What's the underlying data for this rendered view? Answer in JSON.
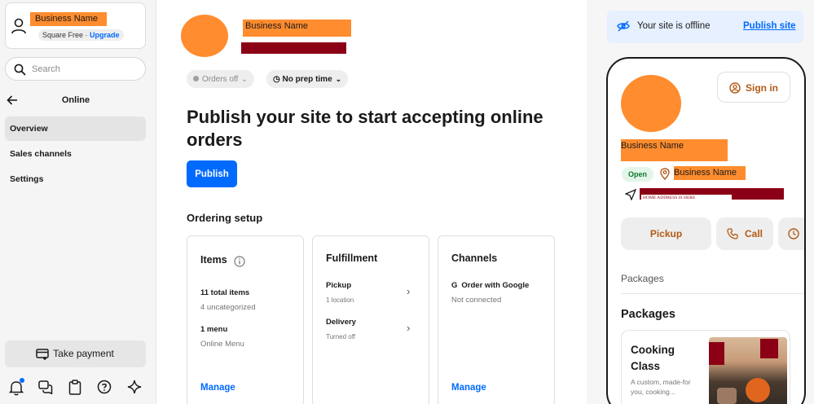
{
  "sidebar": {
    "account": {
      "business_name": "Business Name",
      "plan": "Square Free",
      "upgrade": "Upgrade"
    },
    "search": {
      "placeholder": "Search"
    },
    "section_title": "Online",
    "nav": [
      {
        "label": "Overview",
        "active": true
      },
      {
        "label": "Sales channels",
        "active": false
      },
      {
        "label": "Settings",
        "active": false
      }
    ],
    "take_payment": "Take payment",
    "bottom_icons": [
      "bell-icon",
      "chat-icon",
      "clipboard-icon",
      "help-icon",
      "sparkle-icon"
    ]
  },
  "main": {
    "business_name": "Business Name",
    "pills": {
      "orders": "Orders off",
      "prep": "No prep time"
    },
    "headline": "Publish your site to start accepting online orders",
    "publish_label": "Publish",
    "setup_title": "Ordering setup",
    "cards": {
      "items": {
        "title": "Items",
        "total": "11 total items",
        "uncategorized": "4 uncategorized",
        "menu": "1 menu",
        "menu_name": "Online Menu",
        "manage": "Manage"
      },
      "fulfillment": {
        "title": "Fulfillment",
        "pickup": "Pickup",
        "pickup_sub": "1 location",
        "delivery": "Delivery",
        "delivery_sub": "Turned off"
      },
      "channels": {
        "title": "Channels",
        "google": "Order with Google",
        "google_status": "Not connected",
        "manage": "Manage"
      }
    }
  },
  "right": {
    "banner": {
      "text": "Your site is offline",
      "link": "Publish site"
    },
    "preview": {
      "sign_in": "Sign in",
      "business_name": "Business Name",
      "status": "Open",
      "location_name": "Business Name",
      "address": "HOME ADDRESS IS HERE",
      "buttons": {
        "pickup": "Pickup",
        "call": "Call"
      },
      "packages_small": "Packages",
      "packages_title": "Packages",
      "package_card": {
        "title": "Cooking Class",
        "description": "A custom, made-for you, cooking..."
      }
    }
  },
  "colors": {
    "accent": "#006aff",
    "brand_orange": "#ff8c2e",
    "redact": "#8b0015",
    "preview_accent": "#b35a16"
  }
}
